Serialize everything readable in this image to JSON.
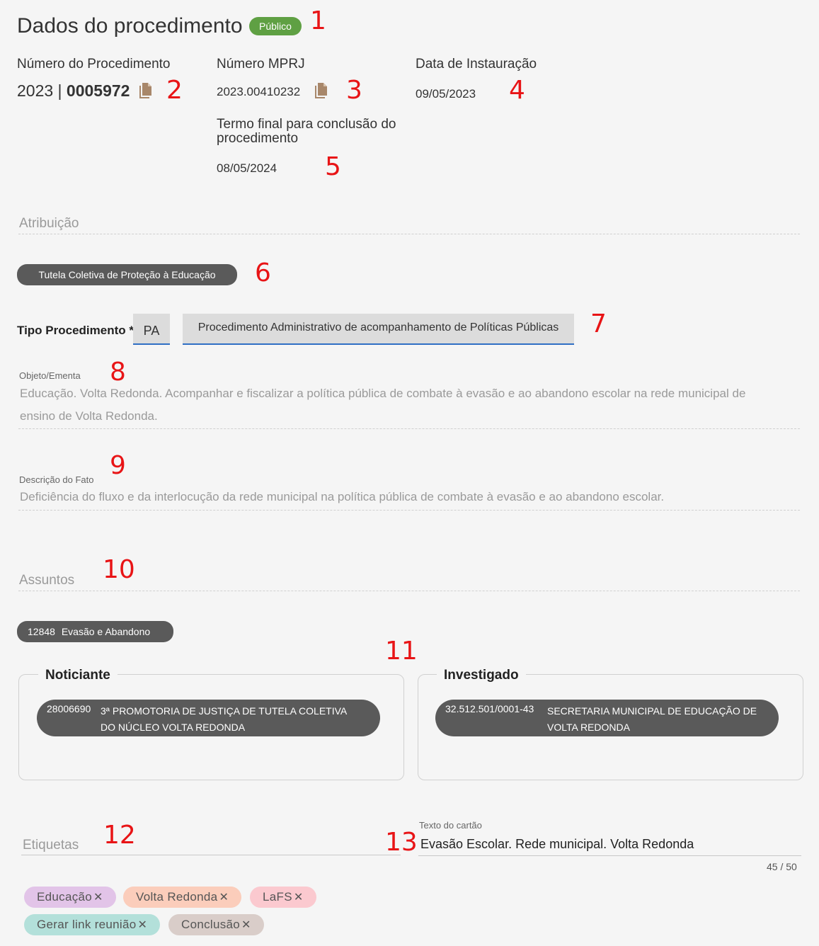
{
  "header": {
    "title": "Dados do procedimento",
    "badge": "Público"
  },
  "annotations": [
    "1",
    "2",
    "3",
    "4",
    "5",
    "6",
    "7",
    "8",
    "9",
    "10",
    "11",
    "12",
    "13"
  ],
  "fields": {
    "numero_procedimento": {
      "label": "Número do Procedimento",
      "year": "2023 | ",
      "number": "0005972"
    },
    "numero_mprj": {
      "label": "Número MPRJ",
      "value": "2023.00410232"
    },
    "data_instauracao": {
      "label": "Data de Instauração",
      "value": "09/05/2023"
    },
    "termo_final": {
      "label_line1": "Termo final para conclusão do",
      "label_line2": "procedimento",
      "value": "08/05/2024"
    }
  },
  "atribuicao": {
    "label": "Atribuição",
    "chip": "Tutela Coletiva de Proteção à Educação"
  },
  "tipo_procedimento": {
    "label": "Tipo Procedimento *",
    "code": "PA",
    "description": "Procedimento Administrativo de acompanhamento de Políticas Públicas"
  },
  "objeto": {
    "label": "Objeto/Ementa",
    "line1": "Educação. Volta Redonda. Acompanhar e fiscalizar a política pública de combate à evasão e ao abandono escolar na rede municipal de",
    "line2": "ensino de Volta Redonda."
  },
  "descricao": {
    "label": "Descrição do Fato",
    "text": "Deficiência do fluxo e da interlocução da rede municipal na política pública de combate à evasão e ao abandono escolar."
  },
  "assuntos": {
    "label": "Assuntos",
    "chip_code": "12848",
    "chip_text": "Evasão e Abandono"
  },
  "noticiante": {
    "legend": "Noticiante",
    "code": "28006690",
    "line1": "3ª PROMOTORIA DE JUSTIÇA DE TUTELA COLETIVA",
    "line2": "DO NÚCLEO VOLTA REDONDA"
  },
  "investigado": {
    "legend": "Investigado",
    "code": "32.512.501/0001-43",
    "line1": "SECRETARIA MUNICIPAL DE EDUCAÇÃO DE",
    "line2": "VOLTA REDONDA"
  },
  "etiquetas": {
    "label": "Etiquetas"
  },
  "cartao": {
    "label": "Texto do cartão",
    "value": "Evasão Escolar. Rede municipal. Volta Redonda",
    "counter": "45 / 50"
  },
  "tags": [
    {
      "label": "Educação",
      "color": "#e2c4e8"
    },
    {
      "label": "Volta Redonda",
      "color": "#fbcdbb"
    },
    {
      "label": "LaFS",
      "color": "#fbc9cf"
    },
    {
      "label": "Gerar link reunião",
      "color": "#b3e0da"
    },
    {
      "label": "Conclusão",
      "color": "#d9cdc9"
    }
  ],
  "colors": {
    "accent_underline": "#2f6fc4",
    "public_badge": "#5fa043",
    "chip_dark": "#5a5a5a",
    "annotation_red": "#e81416",
    "copy_icon": "#a8876a"
  },
  "icons": {
    "copy": "copy-icon",
    "remove": "close-icon"
  }
}
